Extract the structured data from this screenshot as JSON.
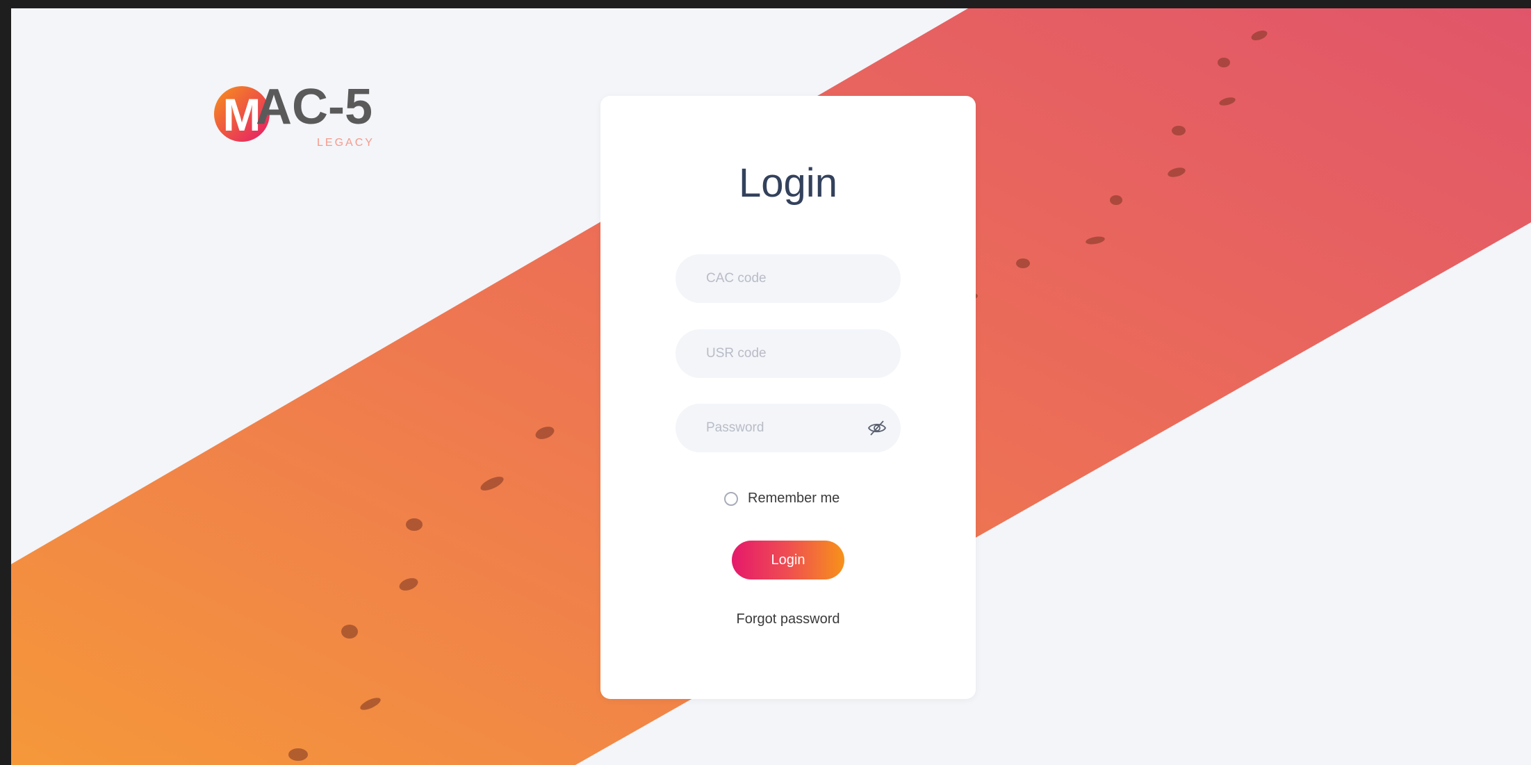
{
  "brand": {
    "logo_letter": "M",
    "logo_text": "AC-5",
    "logo_subtitle": "LEGACY"
  },
  "login_card": {
    "title": "Login",
    "cac_placeholder": "CAC code",
    "usr_placeholder": "USR code",
    "password_placeholder": "Password",
    "remember_label": "Remember me",
    "remember_checked": false,
    "login_button": "Login",
    "forgot_link": "Forgot password"
  },
  "icons": {
    "password_toggle": "eye-slash-icon",
    "logo_mark": "logo-icon"
  },
  "colors": {
    "band_start": "#f5983a",
    "band_end": "#e1556a",
    "button_start": "#e5196b",
    "button_end": "#f7921a",
    "title": "#33415c",
    "page_bg": "#f3f5f9"
  }
}
